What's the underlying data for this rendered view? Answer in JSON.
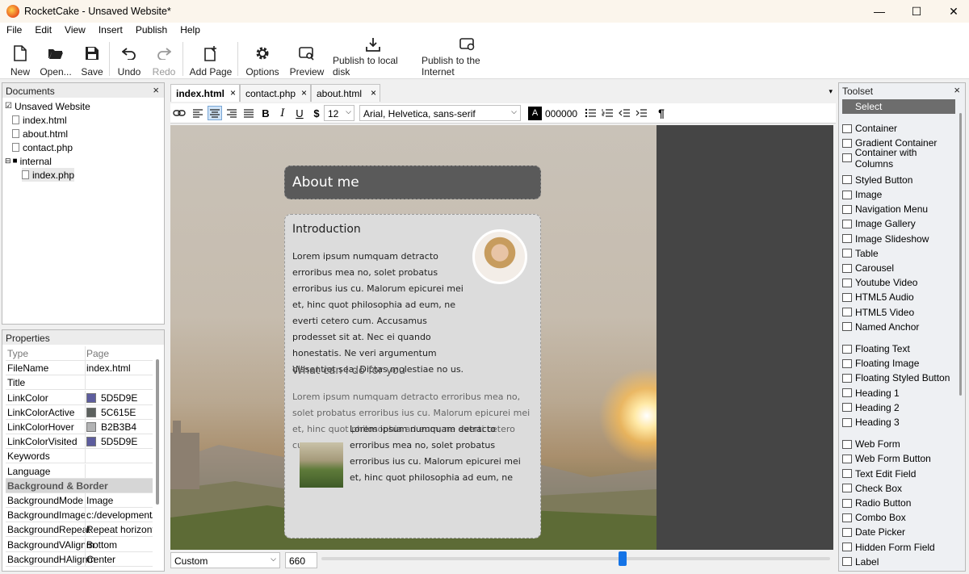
{
  "window": {
    "title": "RocketCake - Unsaved Website*",
    "minimize": "—",
    "maximize": "☐",
    "close": "✕"
  },
  "menu": [
    "File",
    "Edit",
    "View",
    "Insert",
    "Publish",
    "Help"
  ],
  "toolbar": {
    "new": "New",
    "open": "Open...",
    "save": "Save",
    "undo": "Undo",
    "redo": "Redo",
    "add_page": "Add Page",
    "options": "Options",
    "preview": "Preview",
    "publish_local": "Publish to local disk",
    "publish_internet": "Publish to the Internet"
  },
  "documents": {
    "title": "Documents",
    "close": "×",
    "root": "Unsaved Website",
    "items": [
      "index.html",
      "about.html",
      "contact.php"
    ],
    "folder": "internal",
    "folder_items": [
      "index.php"
    ]
  },
  "properties": {
    "title": "Properties",
    "close": "×",
    "rows": [
      {
        "k": "Type",
        "v": "Page"
      },
      {
        "k": "FileName",
        "v": "index.html"
      },
      {
        "k": "Title",
        "v": ""
      },
      {
        "k": "LinkColor",
        "v": "5D5D9E",
        "color": "#5D5D9E"
      },
      {
        "k": "LinkColorActive",
        "v": "5C615E",
        "color": "#5C615E"
      },
      {
        "k": "LinkColorHover",
        "v": "B2B3B4",
        "color": "#B2B3B4"
      },
      {
        "k": "LinkColorVisited",
        "v": "5D5D9E",
        "color": "#5D5D9E"
      },
      {
        "k": "Keywords",
        "v": ""
      },
      {
        "k": "Language",
        "v": ""
      },
      {
        "k": "Background & Border",
        "v": ""
      },
      {
        "k": "BackgroundMode",
        "v": "Image"
      },
      {
        "k": "BackgroundImage",
        "v": "c:/development/"
      },
      {
        "k": "BackgroundRepeat",
        "v": "Repeat horizonta"
      },
      {
        "k": "BackgroundVAlignm",
        "v": "Bottom"
      },
      {
        "k": "BackgroundHAlignm",
        "v": "Center"
      }
    ]
  },
  "tabs": [
    {
      "label": "index.html",
      "close": "×"
    },
    {
      "label": "contact.php",
      "close": "×"
    },
    {
      "label": "about.html",
      "close": "×"
    }
  ],
  "tabs_menu": "▾",
  "format": {
    "font_size": "12",
    "font_family": "Arial, Helvetica, sans-serif",
    "color_letter": "A",
    "color_value": "000000"
  },
  "page": {
    "header": "About me",
    "intro_title": "Introduction",
    "intro_text": "Lorem ipsum numquam detracto erroribus mea no, solet probatus erroribus ius cu. Malorum epicurei mei et, hinc quot philosophia ad eum, ne everti cetero cum. Accusamus prodesset sit at. Nec ei quando honestatis. Ne veri argumentum dissentiet sea. Dictas molestiae no us.",
    "what_title": "What can I do for you",
    "what_text": "Lorem ipsum numquam detracto erroribus mea no, solet probatus erroribus ius cu. Malorum epicurei mei et, hinc quot philosophia ad eum, ne everti cetero cum.",
    "what_text2": "Lorem ipsum numquam detracto erroribus mea no, solet probatus erroribus ius cu. Malorum epicurei mei et, hinc quot philosophia ad eum, ne everti cetero cum. Accusamus prodesset sit at. Nec ei quando honestatis. Ne veri argumentum dissentiet sea. Dictas molestiae no us."
  },
  "status": {
    "zoom_mode": "Custom",
    "width": "660"
  },
  "toolset": {
    "title": "Toolset",
    "close": "×",
    "groups": [
      [
        "Select"
      ],
      [
        "Container",
        "Gradient Container",
        "Container with Columns"
      ],
      [
        "Styled Button",
        "Image",
        "Navigation Menu",
        "Image Gallery",
        "Image Slideshow",
        "Table",
        "Carousel",
        "Youtube Video",
        "HTML5 Audio",
        "HTML5 Video",
        "Named Anchor"
      ],
      [
        "Floating Text",
        "Floating Image",
        "Floating Styled Button",
        "Heading 1",
        "Heading 2",
        "Heading 3"
      ],
      [
        "Web Form",
        "Web Form Button",
        "Text Edit Field",
        "Check Box",
        "Radio Button",
        "Combo Box",
        "Date Picker",
        "Hidden Form Field",
        "Label"
      ]
    ]
  }
}
